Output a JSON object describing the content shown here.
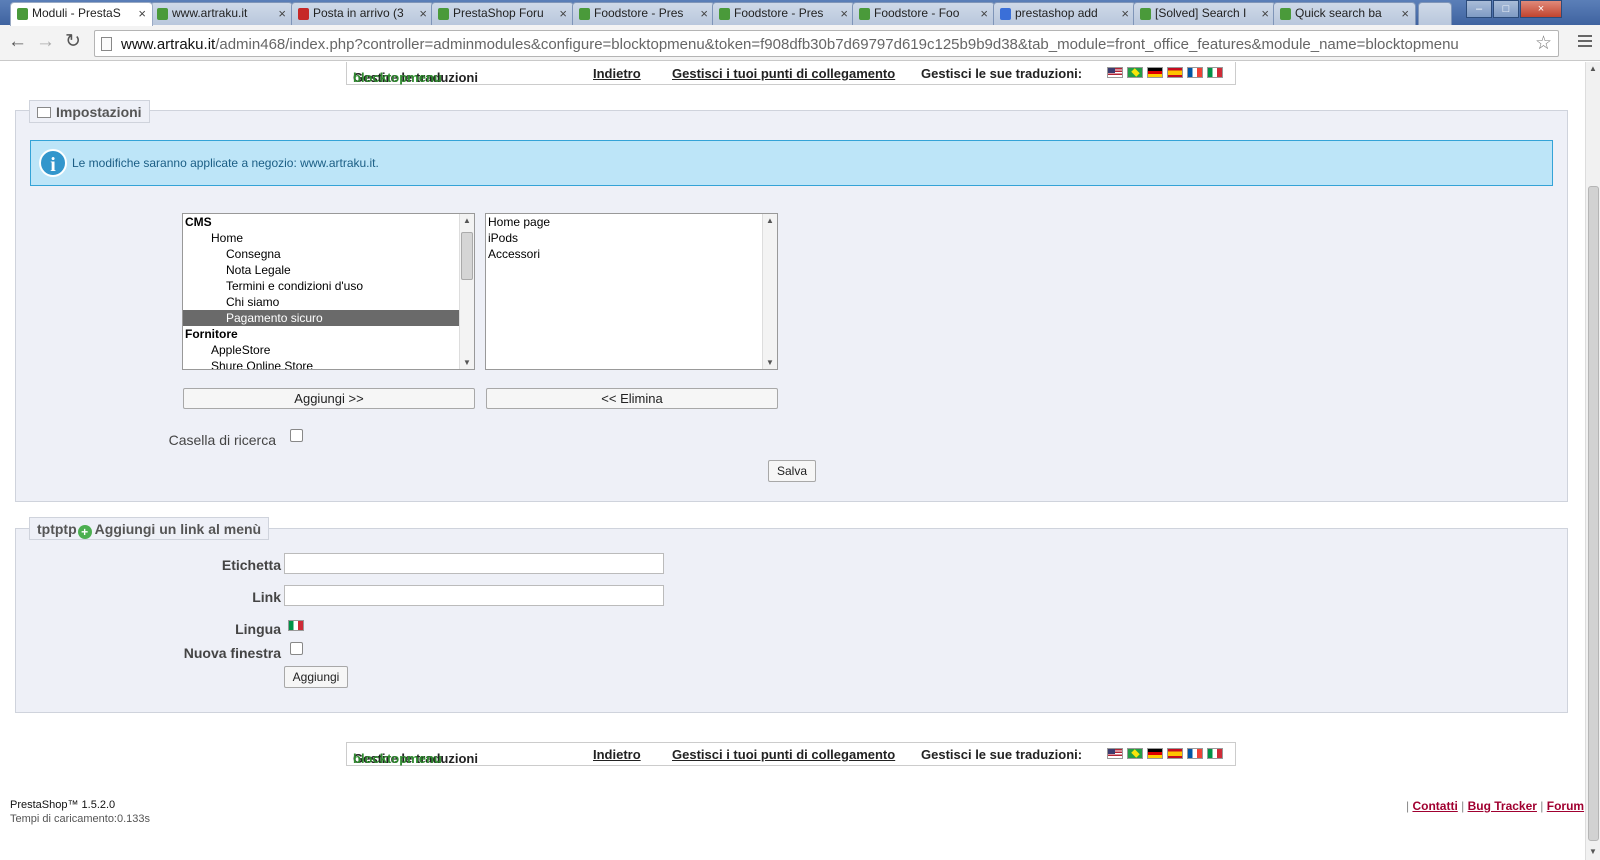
{
  "browser": {
    "tabs": [
      {
        "label": "Moduli - PrestaS",
        "active": true,
        "favicon_color": "#4a9a3a"
      },
      {
        "label": "www.artraku.it",
        "active": false,
        "favicon_color": "#4a9a3a"
      },
      {
        "label": "Posta in arrivo (3",
        "active": false,
        "favicon_color": "#c62828"
      },
      {
        "label": "PrestaShop Foru",
        "active": false,
        "favicon_color": "#4a9a3a"
      },
      {
        "label": "Foodstore - Pres",
        "active": false,
        "favicon_color": "#4a9a3a"
      },
      {
        "label": "Foodstore - Pres",
        "active": false,
        "favicon_color": "#4a9a3a"
      },
      {
        "label": "Foodstore - Foo",
        "active": false,
        "favicon_color": "#4a9a3a"
      },
      {
        "label": "prestashop add",
        "active": false,
        "favicon_color": "#3a6fd8"
      },
      {
        "label": "[Solved] Search I",
        "active": false,
        "favicon_color": "#4a9a3a"
      },
      {
        "label": "Quick search ba",
        "active": false,
        "favicon_color": "#4a9a3a"
      }
    ],
    "close_glyph": "×",
    "window_buttons": {
      "minimize": "–",
      "maximize": "□",
      "close": "×"
    },
    "nav": {
      "back": "←",
      "forward": "→",
      "reload": "↻"
    },
    "url_host": "www.artraku.it",
    "url_path": "/admin468/index.php?controller=adminmodules&configure=blocktopmenu&token=f908dfb30b7d69797d619c125b9b9d38&tab_module=front_office_features&module_name=blocktopmenu",
    "star_glyph": "☆"
  },
  "translation_bar": {
    "manage_prefix": "Gestire le traduzioni",
    "module_name": "blocktopmenu",
    "back_link": "Indietro",
    "hooks_link": "Gestisci i tuoi punti di collegamento",
    "translations_label": "Gestisci le sue traduzioni:",
    "flags": [
      "en-flag",
      "br-flag",
      "de-flag",
      "es-flag",
      "fr-flag",
      "it-flag"
    ]
  },
  "settings": {
    "legend": "Impostazioni",
    "info_message": "Le modifiche saranno applicate a negozio: www.artraku.it.",
    "available_items": [
      {
        "label": "CMS",
        "level": 0,
        "group": true
      },
      {
        "label": "Home",
        "level": 1
      },
      {
        "label": "Consegna",
        "level": 2
      },
      {
        "label": "Nota Legale",
        "level": 2
      },
      {
        "label": "Termini e condizioni d'uso",
        "level": 2
      },
      {
        "label": "Chi siamo",
        "level": 2
      },
      {
        "label": "Pagamento sicuro",
        "level": 2,
        "selected": true
      },
      {
        "label": "Fornitore",
        "level": 0,
        "group": true
      },
      {
        "label": "AppleStore",
        "level": 1
      },
      {
        "label": "Shure Online Store",
        "level": 1
      }
    ],
    "selected_items": [
      "Home page",
      "iPods",
      "Accessori"
    ],
    "add_button": "Aggiungi >>",
    "remove_button": "<< Elimina",
    "search_box_label": "Casella di ricerca",
    "save_button": "Salva"
  },
  "add_link": {
    "legend_prefix": "tptptp",
    "legend": "Aggiungi un link al menù",
    "label_field": "Etichetta",
    "link_field": "Link",
    "language_label": "Lingua",
    "new_window_label": "Nuova finestra",
    "add_button": "Aggiungi"
  },
  "footer": {
    "version": "PrestaShop™ 1.5.2.0",
    "load_time": "Tempi di caricamento:0.133s",
    "links": [
      "Contatti",
      "Bug Tracker",
      "Forum"
    ]
  },
  "colors": {
    "info_bg": "#bde5f8",
    "info_border": "#34a3d7",
    "fieldset_bg": "#eef0f7",
    "module_name": "#2e8b2e",
    "footer_links": "#a00030"
  }
}
